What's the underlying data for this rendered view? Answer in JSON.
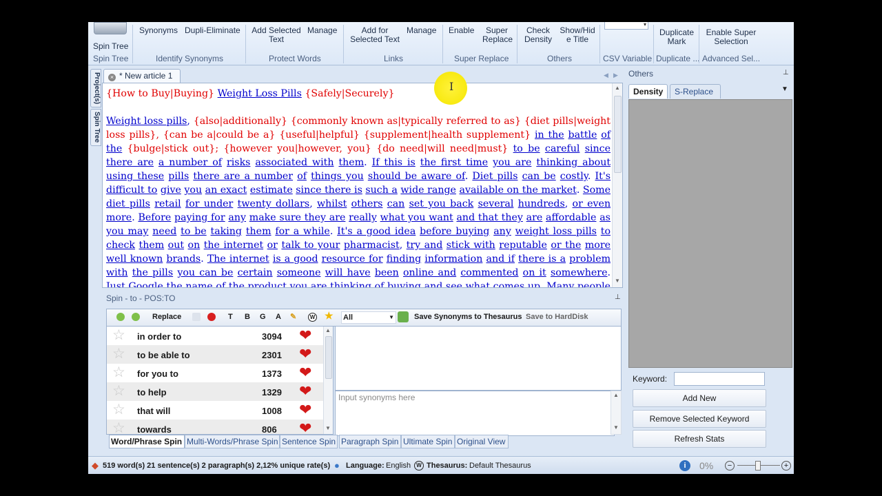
{
  "ribbon": {
    "buttons": [
      {
        "id": "spin-tree",
        "label": "Spin Tree"
      },
      {
        "id": "synonyms",
        "label": "Synonyms"
      },
      {
        "id": "dupli-eliminate",
        "label": "Dupli-Eliminate"
      },
      {
        "id": "add-selected-text",
        "label": "Add Selected Text"
      },
      {
        "id": "manage-words",
        "label": "Manage"
      },
      {
        "id": "add-for-selected-text",
        "label": "Add for Selected Text"
      },
      {
        "id": "manage-links",
        "label": "Manage"
      },
      {
        "id": "enable",
        "label": "Enable"
      },
      {
        "id": "super-replace",
        "label": "Super Replace"
      },
      {
        "id": "check-density",
        "label": "Check Density"
      },
      {
        "id": "show-hide-title",
        "label": "Show/Hide Title"
      },
      {
        "id": "duplicate-mark",
        "label": "Duplicate Mark"
      },
      {
        "id": "enable-super-selection",
        "label": "Enable Super Selection"
      }
    ],
    "groups": {
      "spin_tree": "Spin Tree",
      "identify_synonyms": "Identify Synonyms",
      "protect_words": "Protect Words",
      "links": "Links",
      "super_replace": "Super Replace",
      "others": "Others",
      "csv_variable": "CSV Variable",
      "duplicate": "Duplicate ...",
      "advanced_sel": "Advanced Sel..."
    }
  },
  "side_tabs": {
    "projects": "Project(s)",
    "spin_tree": "Spin Tree"
  },
  "editor": {
    "tab_title": "* New article 1",
    "paragraphs": [
      [
        {
          "t": "{How to Buy|Buying}",
          "c": "spin"
        },
        {
          "t": " "
        },
        {
          "t": "Weight Loss Pills",
          "c": "w"
        },
        {
          "t": " "
        },
        {
          "t": "{Safely|Securely}",
          "c": "spin"
        }
      ],
      [
        {
          "t": "Weight loss pills",
          "c": "w"
        },
        {
          "t": ", "
        },
        {
          "t": "{also|additionally} {commonly known as|typically referred to as} {diet pills|weight loss pills}, {can be a|could be a} {useful|helpful} {supplement|health supplement}",
          "c": "spin"
        },
        {
          "t": " "
        },
        {
          "t": "in the",
          "c": "w"
        },
        {
          "t": " "
        },
        {
          "t": "battle",
          "c": "w"
        },
        {
          "t": " "
        },
        {
          "t": "of the",
          "c": "w"
        },
        {
          "t": " "
        },
        {
          "t": "{bulge|stick out}; {however you|however, you} {do need|will need|must}",
          "c": "spin"
        },
        {
          "t": " "
        },
        {
          "t": "to be",
          "c": "w"
        },
        {
          "t": " "
        },
        {
          "t": "careful",
          "c": "w"
        },
        {
          "t": " "
        },
        {
          "t": "since there are",
          "c": "w"
        },
        {
          "t": " "
        },
        {
          "t": "a number of",
          "c": "w"
        },
        {
          "t": " "
        },
        {
          "t": "risks",
          "c": "w"
        },
        {
          "t": " "
        },
        {
          "t": "associated with",
          "c": "w"
        },
        {
          "t": " "
        },
        {
          "t": "them",
          "c": "w"
        },
        {
          "t": ". "
        },
        {
          "t": "If this is",
          "c": "w"
        },
        {
          "t": " "
        },
        {
          "t": "the first time",
          "c": "w"
        },
        {
          "t": " "
        },
        {
          "t": "you are",
          "c": "w"
        },
        {
          "t": " "
        },
        {
          "t": "thinking about",
          "c": "w"
        },
        {
          "t": " "
        },
        {
          "t": "using these",
          "c": "w"
        },
        {
          "t": " "
        },
        {
          "t": "pills",
          "c": "w"
        },
        {
          "t": " "
        },
        {
          "t": "there are a number",
          "c": "w"
        },
        {
          "t": " "
        },
        {
          "t": "of",
          "c": "w"
        },
        {
          "t": " "
        },
        {
          "t": "things you",
          "c": "w"
        },
        {
          "t": " "
        },
        {
          "t": "should be aware of",
          "c": "w"
        },
        {
          "t": ".  "
        },
        {
          "t": "Diet pills",
          "c": "w"
        },
        {
          "t": " "
        },
        {
          "t": "can be",
          "c": "w"
        },
        {
          "t": " "
        },
        {
          "t": "costly",
          "c": "w"
        },
        {
          "t": ". "
        },
        {
          "t": "It's",
          "c": "w"
        },
        {
          "t": " "
        },
        {
          "t": "difficult to",
          "c": "w"
        },
        {
          "t": " "
        },
        {
          "t": "give",
          "c": "w"
        },
        {
          "t": " "
        },
        {
          "t": "you",
          "c": "w"
        },
        {
          "t": " "
        },
        {
          "t": "an exact",
          "c": "w"
        },
        {
          "t": " "
        },
        {
          "t": "estimate",
          "c": "w"
        },
        {
          "t": " "
        },
        {
          "t": "since there is",
          "c": "w"
        },
        {
          "t": " "
        },
        {
          "t": "such a",
          "c": "w"
        },
        {
          "t": " "
        },
        {
          "t": "wide range",
          "c": "w"
        },
        {
          "t": " "
        },
        {
          "t": "available on the market",
          "c": "w"
        },
        {
          "t": ". "
        },
        {
          "t": "Some",
          "c": "w"
        },
        {
          "t": " "
        },
        {
          "t": "diet pills",
          "c": "w"
        },
        {
          "t": " "
        },
        {
          "t": "retail",
          "c": "w"
        },
        {
          "t": " "
        },
        {
          "t": "for under",
          "c": "w"
        },
        {
          "t": " "
        },
        {
          "t": "twenty dollars",
          "c": "w"
        },
        {
          "t": ", "
        },
        {
          "t": "whilst",
          "c": "w"
        },
        {
          "t": " "
        },
        {
          "t": "others",
          "c": "w"
        },
        {
          "t": " "
        },
        {
          "t": "can",
          "c": "w"
        },
        {
          "t": " "
        },
        {
          "t": "set you back",
          "c": "w"
        },
        {
          "t": " "
        },
        {
          "t": "several",
          "c": "w"
        },
        {
          "t": " "
        },
        {
          "t": "hundreds",
          "c": "w"
        },
        {
          "t": ", "
        },
        {
          "t": "or even more",
          "c": "w"
        },
        {
          "t": ". "
        },
        {
          "t": "Before",
          "c": "w"
        },
        {
          "t": " "
        },
        {
          "t": "paying for",
          "c": "w"
        },
        {
          "t": " "
        },
        {
          "t": "any",
          "c": "w"
        },
        {
          "t": " "
        },
        {
          "t": "make sure they are",
          "c": "w"
        },
        {
          "t": " "
        },
        {
          "t": "really",
          "c": "w"
        },
        {
          "t": " "
        },
        {
          "t": "what you want",
          "c": "w"
        },
        {
          "t": " "
        },
        {
          "t": "and that they",
          "c": "w"
        },
        {
          "t": " "
        },
        {
          "t": "are",
          "c": "w"
        },
        {
          "t": " "
        },
        {
          "t": "affordable",
          "c": "w"
        },
        {
          "t": " "
        },
        {
          "t": "as you may",
          "c": "w"
        },
        {
          "t": " "
        },
        {
          "t": "need",
          "c": "w"
        },
        {
          "t": " "
        },
        {
          "t": "to be",
          "c": "w"
        },
        {
          "t": " "
        },
        {
          "t": "taking",
          "c": "w"
        },
        {
          "t": " "
        },
        {
          "t": "them",
          "c": "w"
        },
        {
          "t": " "
        },
        {
          "t": "for a while",
          "c": "w"
        },
        {
          "t": ".  "
        },
        {
          "t": "It's a good idea",
          "c": "w"
        },
        {
          "t": " "
        },
        {
          "t": "before buying",
          "c": "w"
        },
        {
          "t": " "
        },
        {
          "t": "any",
          "c": "w"
        },
        {
          "t": " "
        },
        {
          "t": "weight loss pills",
          "c": "w"
        },
        {
          "t": " "
        },
        {
          "t": "to check",
          "c": "w"
        },
        {
          "t": " "
        },
        {
          "t": "them",
          "c": "w"
        },
        {
          "t": " "
        },
        {
          "t": "out",
          "c": "w"
        },
        {
          "t": " "
        },
        {
          "t": "on",
          "c": "w"
        },
        {
          "t": " "
        },
        {
          "t": "the internet",
          "c": "w"
        },
        {
          "t": " "
        },
        {
          "t": "or",
          "c": "w"
        },
        {
          "t": " "
        },
        {
          "t": "talk to your",
          "c": "w"
        },
        {
          "t": " "
        },
        {
          "t": "pharmacist",
          "c": "w"
        },
        {
          "t": ", "
        },
        {
          "t": "try and",
          "c": "w"
        },
        {
          "t": " "
        },
        {
          "t": "stick with",
          "c": "w"
        },
        {
          "t": " "
        },
        {
          "t": "reputable",
          "c": "w"
        },
        {
          "t": " "
        },
        {
          "t": "or the",
          "c": "w"
        },
        {
          "t": " "
        },
        {
          "t": "more",
          "c": "w"
        },
        {
          "t": " "
        },
        {
          "t": "well known",
          "c": "w"
        },
        {
          "t": " "
        },
        {
          "t": "brands",
          "c": "w"
        },
        {
          "t": ". "
        },
        {
          "t": "The internet",
          "c": "w"
        },
        {
          "t": " "
        },
        {
          "t": "is a good",
          "c": "w"
        },
        {
          "t": " "
        },
        {
          "t": "resource for",
          "c": "w"
        },
        {
          "t": " "
        },
        {
          "t": "finding",
          "c": "w"
        },
        {
          "t": " "
        },
        {
          "t": "information",
          "c": "w"
        },
        {
          "t": " "
        },
        {
          "t": "and if",
          "c": "w"
        },
        {
          "t": " "
        },
        {
          "t": "there is a",
          "c": "w"
        },
        {
          "t": " "
        },
        {
          "t": "problem with",
          "c": "w"
        },
        {
          "t": " "
        },
        {
          "t": "the pills",
          "c": "w"
        },
        {
          "t": " "
        },
        {
          "t": "you can be",
          "c": "w"
        },
        {
          "t": " "
        },
        {
          "t": "certain",
          "c": "w"
        },
        {
          "t": " "
        },
        {
          "t": "someone",
          "c": "w"
        },
        {
          "t": " "
        },
        {
          "t": "will have",
          "c": "w"
        },
        {
          "t": " "
        },
        {
          "t": "been",
          "c": "w"
        },
        {
          "t": " "
        },
        {
          "t": "online and",
          "c": "w"
        },
        {
          "t": " "
        },
        {
          "t": "commented",
          "c": "w"
        },
        {
          "t": " "
        },
        {
          "t": "on it",
          "c": "w"
        },
        {
          "t": " "
        },
        {
          "t": "somewhere",
          "c": "w"
        },
        {
          "t": ". "
        },
        {
          "t": "Just",
          "c": "w"
        },
        {
          "t": " "
        },
        {
          "t": "Google",
          "c": "w"
        },
        {
          "t": " "
        },
        {
          "t": "the",
          "c": "w"
        },
        {
          "t": " "
        },
        {
          "t": "name of the product you are thinking of buying and see what comes up.  Many people trying to lose",
          "c": "w"
        }
      ]
    ]
  },
  "others_panel": {
    "title": "Others",
    "tabs": [
      "Density",
      "S-Replace"
    ],
    "keyword_label": "Keyword:",
    "keyword_value": "",
    "buttons": [
      "Add New",
      "Remove Selected Keyword",
      "Refresh Stats"
    ]
  },
  "spin_panel": {
    "title": "Spin - to - POS:TO",
    "toolbar": {
      "replace": "Replace",
      "t": "T",
      "b": "B",
      "g": "G",
      "a": "A",
      "filter": "All",
      "save_syn": "Save Synonyms to Thesaurus",
      "save_disk": "Save to HardDisk"
    },
    "rows": [
      {
        "phrase": "in order to",
        "count": "3094"
      },
      {
        "phrase": "to be able to",
        "count": "2301"
      },
      {
        "phrase": "for you to",
        "count": "1373"
      },
      {
        "phrase": "to help",
        "count": "1329"
      },
      {
        "phrase": "that will",
        "count": "1008"
      },
      {
        "phrase": "towards",
        "count": "806"
      }
    ],
    "syn_placeholder": "Input synonyms here",
    "tabs": [
      "Word/Phrase Spin",
      "Multi-Words/Phrase Spin",
      "Sentence Spin",
      "Paragraph Spin",
      "Ultimate Spin",
      "Original View"
    ]
  },
  "status": {
    "stats": "519 word(s) 21 sentence(s) 2 paragraph(s) 2,12% unique rate(s)",
    "language_label": "Language:",
    "language": "English",
    "thesaurus_label": "Thesaurus:",
    "thesaurus": "Default Thesaurus",
    "zoom": "0%"
  }
}
